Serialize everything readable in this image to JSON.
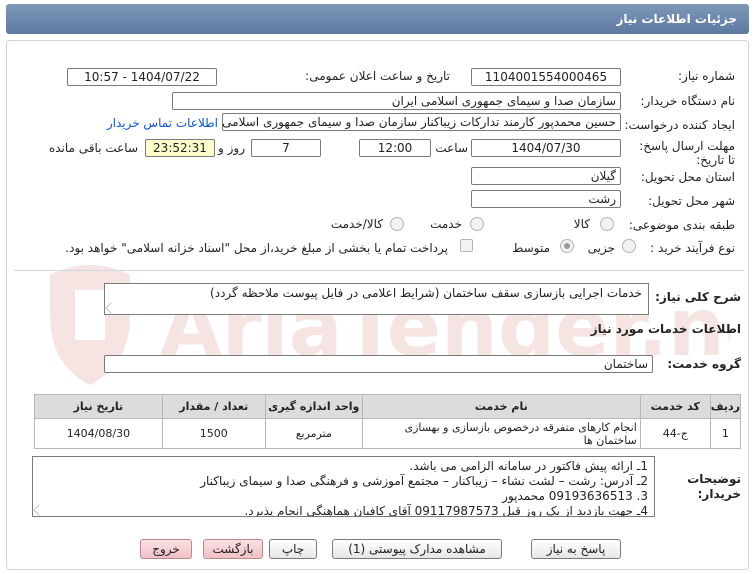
{
  "header": {
    "title": "جزئیات اطلاعات نیاز"
  },
  "fields": {
    "need_number_label": "شماره نیاز:",
    "need_number": "1104001554000465",
    "announce_label": "تاریخ و ساعت اعلان عمومی:",
    "announce_value": "1404/07/22 - 10:57",
    "buyer_org_label": "نام دستگاه خریدار:",
    "buyer_org": "سازمان صدا و سیمای جمهوری اسلامی ایران",
    "creator_label": "ایجاد کننده درخواست:",
    "creator": "حسین محمدپور کارمند تدارکات زیباکنار سازمان صدا و سیمای جمهوری اسلامی",
    "contact_link": "اطلاعات تماس خریدار",
    "deadline_label": "مهلت ارسال پاسخ: تا تاریخ:",
    "deadline_date": "1404/07/30",
    "time_label": "ساعت",
    "deadline_time": "12:00",
    "days": "7",
    "days_label": "روز و",
    "remaining": "23:52:31",
    "remaining_label": "ساعت باقی مانده",
    "province_label": "استان محل تحویل:",
    "province": "گیلان",
    "city_label": "شهر محل تحویل:",
    "city": "رشت",
    "category_label": "طبقه بندی موضوعی:",
    "category_options": [
      "کالا",
      "خدمت",
      "کالا/خدمت"
    ],
    "process_label": "نوع فرآیند خرید :",
    "process_options": [
      "جزیی",
      "متوسط"
    ],
    "payment_note": "پرداخت تمام یا بخشی از مبلغ خرید،از محل \"اسناد خزانه اسلامی\" خواهد بود."
  },
  "description": {
    "label": "شرح کلی نیاز:",
    "value": "خدمات اجرایی بازسازی سقف ساختمان (شرایط اعلامی در فایل پیوست ملاحظه گردد)"
  },
  "services": {
    "section_title": "اطلاعات خدمات مورد نیاز",
    "group_label": "گروه خدمت:",
    "group_value": "ساختمان",
    "columns": [
      "ردیف",
      "کد خدمت",
      "نام خدمت",
      "واحد اندازه گیری",
      "تعداد / مقدار",
      "تاریخ نیاز"
    ],
    "rows": [
      [
        "1",
        "ج-44",
        "انجام کارهای متفرقه درخصوص بازسازی و بهسازی ساختمان ها",
        "مترمربع",
        "1500",
        "1404/08/30"
      ]
    ]
  },
  "buyer_notes": {
    "label": "توضیحات خریدار:",
    "lines": [
      "1ـ ارائه پیش فاکتور در سامانه الزامی می باشد.",
      "2ـ آدرس: رشت – لشت نشاء – زیباکنار – مجتمع آموزشی و فرهنگی صدا و سیمای زیباکنار",
      "3. 09193636513 محمدپور",
      "4ـ جهت بازدید از یک روز قبل 09117987573 آقای کافیان هماهنگی انجام پذیرد."
    ]
  },
  "buttons": {
    "reply": "پاسخ به نیاز",
    "attachments": "مشاهده مدارک پیوستی (1)",
    "print": "چاپ",
    "back": "بازگشت",
    "exit": "خروج"
  },
  "watermark": "AriaTender.net",
  "colors": {
    "header": "#6a86ab",
    "link": "#1155cc",
    "highlight": "#ffffcc"
  }
}
